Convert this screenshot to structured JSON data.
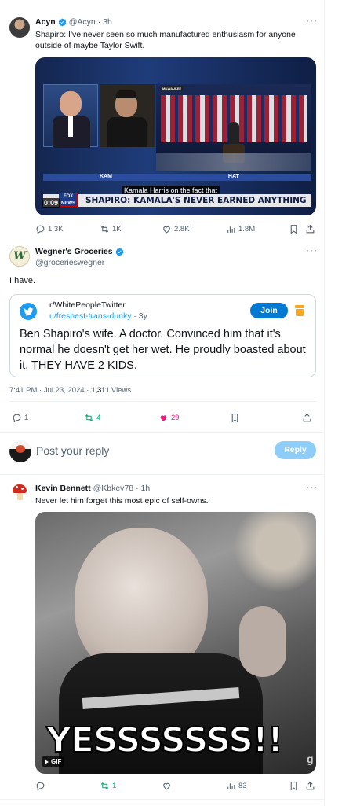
{
  "tweet1": {
    "name": "Acyn",
    "handle": "@Acyn",
    "time": "3h",
    "text": "Shapiro: I've never seen so much manufactured enthusiasm for anyone outside of maybe Taylor Swift.",
    "video": {
      "duration": "0:09",
      "caption_line": "Kamala Harris on the fact that",
      "chyron": "SHAPIRO: KAMALA'S NEVER EARNED ANYTHING",
      "network": "FOX NEWS",
      "chyron_top_fragment": "KAM",
      "chyron_top_fragment2": "HAT",
      "live_tag": "MILWAUKEE"
    },
    "actions": {
      "replies": "1.3K",
      "reposts": "1K",
      "likes": "2.8K",
      "views": "1.8M"
    }
  },
  "tweet2": {
    "name": "Wegner's Groceries",
    "handle": "@grocerieswegner",
    "text": "I have.",
    "quote": {
      "subreddit": "r/WhitePeopleTwitter",
      "user": "u/freshest-trans-dunky",
      "age": "· 3y",
      "join_label": "Join",
      "text": "Ben Shapiro's wife. A doctor. Convinced him that it's normal he doesn't get her wet. He proudly boasted about it. THEY HAVE 2 KIDS."
    },
    "meta": {
      "timestamp": "7:41 PM · Jul 23, 2024 · ",
      "views_count": "1,311",
      "views_label": " Views"
    },
    "actions": {
      "replies": "1",
      "reposts": "4",
      "likes": "29"
    }
  },
  "reply_box": {
    "placeholder": "Post your reply",
    "button_label": "Reply"
  },
  "tweet3": {
    "name": "Kevin Bennett",
    "handle": "@Kbkev78",
    "time": "· 1h",
    "text": "Never let him forget this most epic of self-owns.",
    "gif": {
      "badge": "GIF",
      "overlay_text": "YESSSSSSS!!",
      "watermark": "g"
    },
    "actions": {
      "replies": "",
      "reposts": "1",
      "likes": "",
      "views": "83"
    }
  },
  "colors": {
    "blue": "#1d9bf0",
    "green": "#00ba7c",
    "pink": "#f91880",
    "gray": "#536471",
    "reddit_blue": "#0079d3"
  }
}
